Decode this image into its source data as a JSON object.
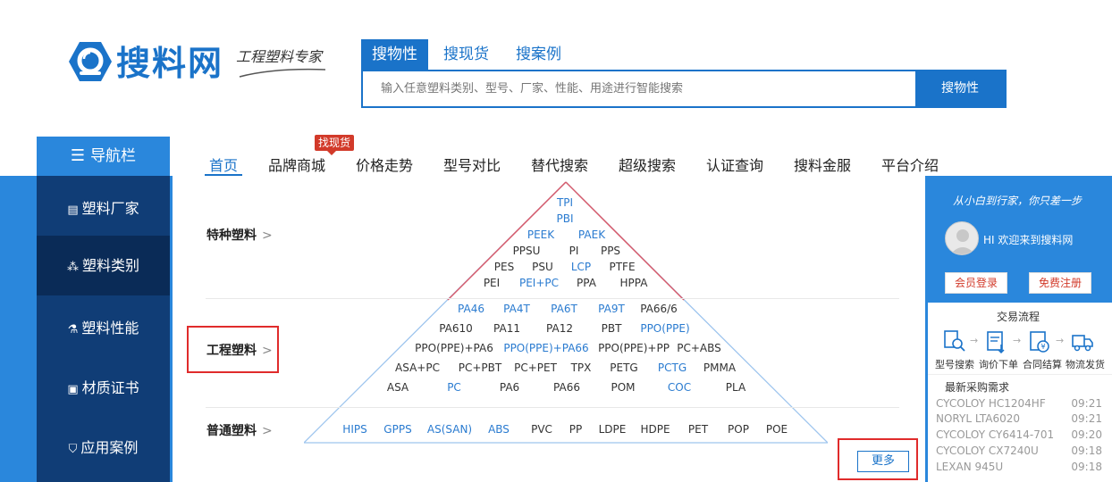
{
  "header": {
    "logo_text": "搜料网",
    "slogan": "工程塑料专家",
    "search_tabs": [
      "搜物性",
      "搜现货",
      "搜案例"
    ],
    "search_placeholder": "输入任意塑料类别、型号、厂家、性能、用途进行智能搜索",
    "search_button": "搜物性"
  },
  "nav": {
    "head_label": "导航栏",
    "items": [
      "首页",
      "品牌商城",
      "价格走势",
      "型号对比",
      "替代搜索",
      "超级搜索",
      "认证查询",
      "搜料金服",
      "平台介绍"
    ],
    "badge": "找现货"
  },
  "sidebar": {
    "items": [
      "塑料厂家",
      "塑料类别",
      "塑料性能",
      "材质证书",
      "应用案例"
    ],
    "active_index": 1
  },
  "categories": [
    {
      "label": "特种塑料",
      "chev": ">"
    },
    {
      "label": "工程塑料",
      "chev": ">"
    },
    {
      "label": "普通塑料",
      "chev": ">"
    }
  ],
  "materials": {
    "special": [
      [
        "TPI"
      ],
      [
        "PBI"
      ],
      [
        "PEEK",
        "PAEK"
      ],
      [
        "PPSU",
        "PI",
        "PPS"
      ],
      [
        "PES",
        "PSU",
        "LCP",
        "PTFE"
      ],
      [
        "PEI",
        "PEI+PC",
        "PPA",
        "HPPA"
      ]
    ],
    "engineering": [
      [
        "PA46",
        "PA4T",
        "PA6T",
        "PA9T",
        "PA66/6"
      ],
      [
        "PA610",
        "PA11",
        "PA12",
        "PBT",
        "PPO(PPE)"
      ],
      [
        "PPO(PPE)+PA6",
        "PPO(PPE)+PA66",
        "PPO(PPE)+PP",
        "PC+ABS"
      ],
      [
        "ASA+PC",
        "PC+PBT",
        "PC+PET",
        "TPX",
        "PETG",
        "PCTG",
        "PMMA"
      ],
      [
        "ASA",
        "PC",
        "PA6",
        "PA66",
        "POM",
        "COC",
        "PLA"
      ]
    ],
    "general": [
      "HIPS",
      "GPPS",
      "AS(SAN)",
      "ABS",
      "PVC",
      "PP",
      "LDPE",
      "HDPE",
      "PET",
      "POP",
      "POE"
    ]
  },
  "more_button": "更多",
  "right_panel": {
    "slogan": "从小白到行家，你只差一步",
    "greeting": "HI 欢迎来到搜料网",
    "login_button": "会员登录",
    "register_button": "免费注册",
    "flow_title": "交易流程",
    "flow_steps": [
      "型号搜索",
      "询价下单",
      "合同结算",
      "物流发货"
    ],
    "needs_title": "最新采购需求",
    "needs": [
      {
        "name": "CYCOLOY HC1204HF",
        "time": "09:21"
      },
      {
        "name": "NORYL LTA6020",
        "time": "09:21"
      },
      {
        "name": "CYCOLOY CY6414-701",
        "time": "09:20"
      },
      {
        "name": "CYCOLOY CX7240U",
        "time": "09:18"
      },
      {
        "name": "LEXAN 945U",
        "time": "09:18"
      }
    ]
  },
  "colors": {
    "brand_blue": "#1a73c9",
    "band_blue": "#2a87dc",
    "sidebar_navy": "#103d76",
    "highlight_red": "#e02b2b",
    "material_blue": "#2a7bd0"
  }
}
